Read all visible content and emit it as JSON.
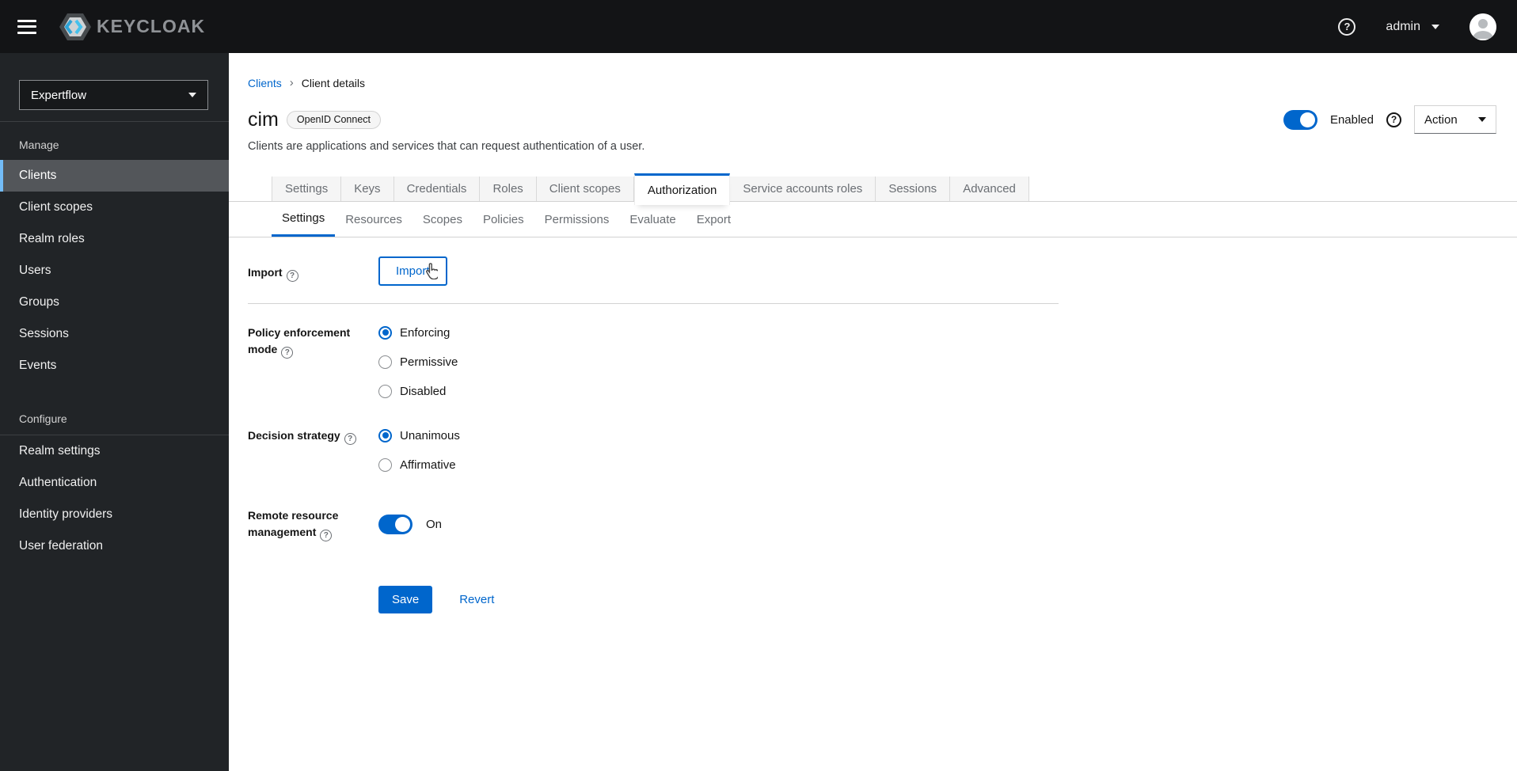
{
  "topbar": {
    "brand": "KEYCLOAK",
    "user": "admin"
  },
  "icons": {
    "question": "?"
  },
  "sidebar": {
    "realm": "Expertflow",
    "manage": {
      "label": "Manage",
      "items": [
        "Clients",
        "Client scopes",
        "Realm roles",
        "Users",
        "Groups",
        "Sessions",
        "Events"
      ],
      "active": "Clients"
    },
    "configure": {
      "label": "Configure",
      "items": [
        "Realm settings",
        "Authentication",
        "Identity providers",
        "User federation"
      ]
    }
  },
  "breadcrumb": {
    "parent": "Clients",
    "separator": "›",
    "current": "Client details"
  },
  "header": {
    "title": "cim",
    "badge": "OpenID Connect",
    "subtitle": "Clients are applications and services that can request authentication of a user.",
    "enabled_label": "Enabled",
    "action_label": "Action"
  },
  "tabs": {
    "items": [
      "Settings",
      "Keys",
      "Credentials",
      "Roles",
      "Client scopes",
      "Authorization",
      "Service accounts roles",
      "Sessions",
      "Advanced"
    ],
    "active": "Authorization"
  },
  "subtabs": {
    "items": [
      "Settings",
      "Resources",
      "Scopes",
      "Policies",
      "Permissions",
      "Evaluate",
      "Export"
    ],
    "active": "Settings"
  },
  "form": {
    "import": {
      "label": "Import",
      "button": "Import"
    },
    "policy": {
      "label": "Policy enforcement mode",
      "options": [
        "Enforcing",
        "Permissive",
        "Disabled"
      ],
      "selected": "Enforcing"
    },
    "decision": {
      "label": "Decision strategy",
      "options": [
        "Unanimous",
        "Affirmative"
      ],
      "selected": "Unanimous"
    },
    "remote": {
      "label": "Remote resource management",
      "state": "On"
    },
    "actions": {
      "save": "Save",
      "revert": "Revert"
    }
  },
  "colors": {
    "accent": "#0066cc",
    "topbar_bg": "#131416",
    "sidebar_bg": "#212427",
    "sidebar_active_bg": "#53565a",
    "sidebar_active_border": "#73bcf7",
    "tab_inactive_bg": "#f5f5f5",
    "muted_text": "#6a6e73"
  }
}
